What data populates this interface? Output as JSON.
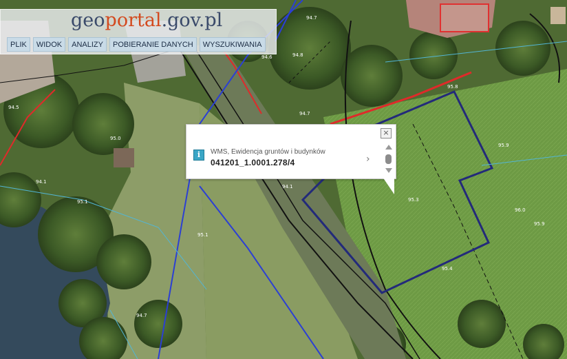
{
  "logo": {
    "part1": "ge",
    "part2": "o",
    "part3": "portal",
    "part4": ".gov.pl"
  },
  "menu": [
    "PLIK",
    "WIDOK",
    "ANALIZY",
    "POBIERANIE DANYCH",
    "WYSZUKIWANIA"
  ],
  "popup": {
    "close_icon": "close-icon",
    "info_icon": "i",
    "layer": "WMS, Ewidencja gruntów i budynków",
    "parcel_id": "041201_1.0001.278/4",
    "next": "›"
  },
  "map_labels": [
    "94.7",
    "94.6",
    "94.8",
    "95.8",
    "94.5",
    "94.7",
    "95.0",
    "94.1",
    "94.1",
    "95.1",
    "95.3",
    "95.9",
    "96.0",
    "95.9",
    "95.4",
    "95.1",
    "94.7"
  ],
  "colors": {
    "parcel_boundary": "#232a7a",
    "road_boundary": "#e32b2b",
    "utility_line": "#2b3fd4",
    "water": "#324a63"
  }
}
